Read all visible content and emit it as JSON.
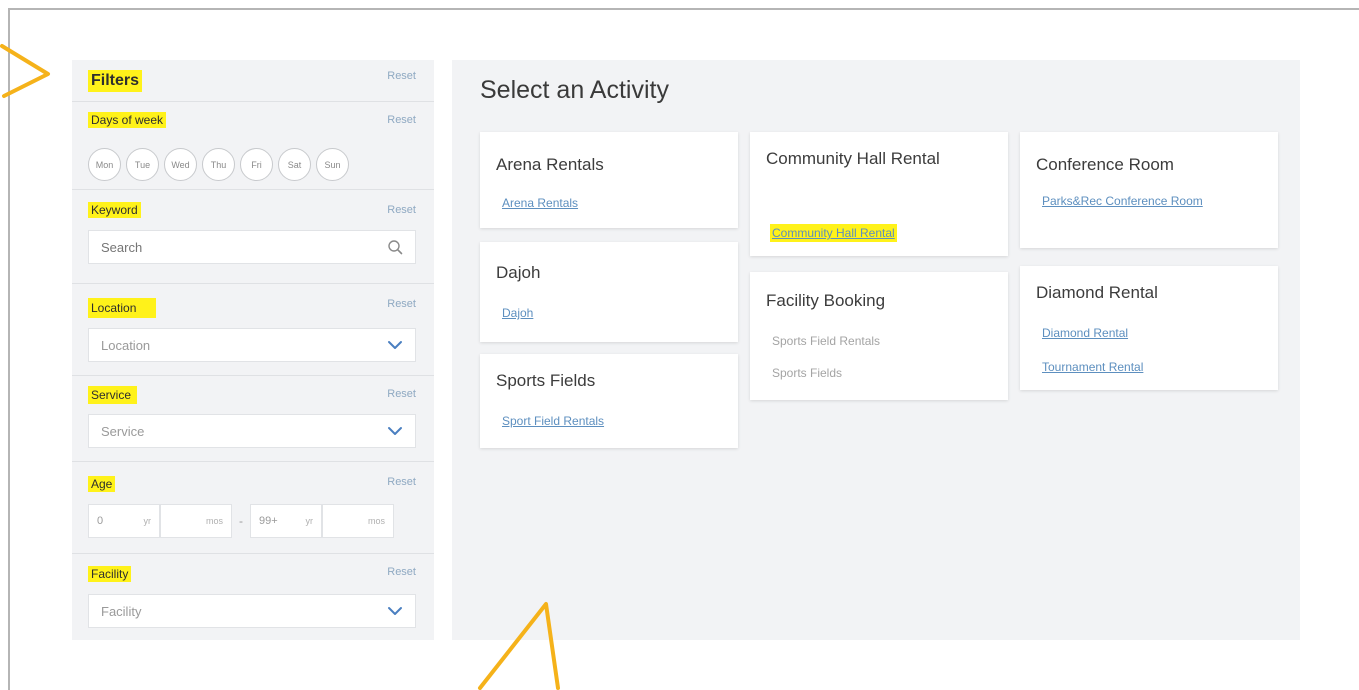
{
  "filters": {
    "title": "Filters",
    "reset_label": "Reset",
    "days_of_week": {
      "label": "Days of week",
      "days": [
        "Mon",
        "Tue",
        "Wed",
        "Thu",
        "Fri",
        "Sat",
        "Sun"
      ]
    },
    "keyword": {
      "label": "Keyword",
      "placeholder": "Search"
    },
    "location": {
      "label": "Location",
      "value": "Location"
    },
    "service": {
      "label": "Service",
      "value": "Service"
    },
    "age": {
      "label": "Age",
      "min_years": "0",
      "min_years_unit": "yr",
      "min_months_unit": "mos",
      "separator": "-",
      "max_years": "99+",
      "max_years_unit": "yr",
      "max_months_unit": "mos"
    },
    "facility": {
      "label": "Facility",
      "value": "Facility"
    }
  },
  "main": {
    "title": "Select an Activity",
    "cards": {
      "arena": {
        "title": "Arena Rentals",
        "links": [
          "Arena Rentals"
        ]
      },
      "community": {
        "title": "Community Hall Rental",
        "links": [
          "Community Hall Rental"
        ]
      },
      "conference": {
        "title": "Conference Room",
        "links": [
          "Parks&Rec Conference Room"
        ]
      },
      "dajoh": {
        "title": "Dajoh",
        "links": [
          "Dajoh"
        ]
      },
      "facility": {
        "title": "Facility Booking",
        "items": [
          "Sports Field Rentals",
          "Sports Fields"
        ]
      },
      "diamond": {
        "title": "Diamond Rental",
        "links": [
          "Diamond Rental",
          "Tournament Rental"
        ]
      },
      "sports": {
        "title": "Sports Fields",
        "links": [
          "Sport Field Rentals"
        ]
      }
    }
  },
  "colors": {
    "highlight": "#fff21a",
    "annotation_arrow": "#f5b21a",
    "link": "#5d8fbf",
    "panel_bg": "#f2f3f5"
  },
  "icons": [
    "search-icon",
    "chevron-down-icon",
    "annotation-arrow-icon"
  ]
}
